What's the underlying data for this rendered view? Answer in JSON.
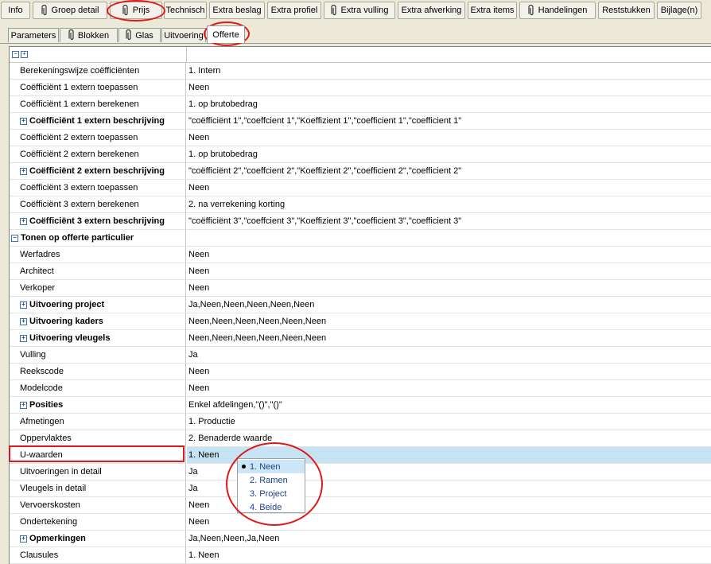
{
  "toolbar": {
    "buttons": [
      {
        "label": "Info",
        "icon": ""
      },
      {
        "label": "Groep detail",
        "icon": "paperclip-icon"
      },
      {
        "label": "Prijs",
        "icon": "paperclip-icon"
      },
      {
        "label": "Technisch",
        "icon": ""
      },
      {
        "label": "Extra beslag",
        "icon": ""
      },
      {
        "label": "Extra profiel",
        "icon": ""
      },
      {
        "label": "Extra vulling",
        "icon": "paperclip-icon"
      },
      {
        "label": "Extra afwerking",
        "icon": ""
      },
      {
        "label": "Extra items",
        "icon": ""
      },
      {
        "label": "Handelingen",
        "icon": "paperclip-icon"
      },
      {
        "label": "Reststukken",
        "icon": ""
      },
      {
        "label": "Bijlage(n)",
        "icon": ""
      }
    ]
  },
  "tabs": [
    {
      "label": "Parameters"
    },
    {
      "label": "Blokken",
      "icon": "paperclip-icon"
    },
    {
      "label": "Glas",
      "icon": "paperclip-icon"
    },
    {
      "label": "Uitvoering"
    },
    {
      "label": "Offerte",
      "active": true
    }
  ],
  "grid": {
    "header_toggle": [
      "−",
      "+"
    ],
    "rows": [
      {
        "label": "Berekeningswijze coëfficiënten",
        "value": "1. Intern"
      },
      {
        "label": "Coëfficiënt 1 extern toepassen",
        "value": "Neen"
      },
      {
        "label": "Coëfficiënt 1 extern berekenen",
        "value": "1. op brutobedrag"
      },
      {
        "label": "Coëfficiënt 1  extern beschrijving",
        "value": "\"coëfficiënt 1\",\"coeffcient 1\",\"Koeffizient 1\",\"coefficient 1\",\"coefficient 1\"",
        "expand": "+",
        "bold": true
      },
      {
        "label": "Coëfficiënt 2 extern toepassen",
        "value": "Neen"
      },
      {
        "label": "Coëfficiënt 2 extern berekenen",
        "value": "1. op brutobedrag"
      },
      {
        "label": "Coëfficiënt 2  extern beschrijving",
        "value": "\"coëfficiënt 2\",\"coeffcient 2\",\"Koeffizient 2\",\"coefficient 2\",\"coefficient 2\"",
        "expand": "+",
        "bold": true
      },
      {
        "label": "Coëfficiënt 3 extern toepassen",
        "value": "Neen"
      },
      {
        "label": "Coëfficiënt 3  extern berekenen",
        "value": "2. na verrekening korting"
      },
      {
        "label": "Coëfficiënt 3  extern beschrijving",
        "value": "\"coëfficiënt 3\",\"coeffcient 3\",\"Koeffizient 3\",\"coefficient 3\",\"coefficient 3\"",
        "expand": "+",
        "bold": true
      },
      {
        "label": "Tonen op offerte particulier",
        "value": "",
        "expand": "−",
        "group": true
      },
      {
        "label": "Werfadres",
        "value": "Neen"
      },
      {
        "label": "Architect",
        "value": "Neen"
      },
      {
        "label": "Verkoper",
        "value": "Neen"
      },
      {
        "label": "Uitvoering project",
        "value": "Ja,Neen,Neen,Neen,Neen,Neen",
        "expand": "+",
        "bold": true
      },
      {
        "label": "Uitvoering kaders",
        "value": "Neen,Neen,Neen,Neen,Neen,Neen",
        "expand": "+",
        "bold": true
      },
      {
        "label": "Uitvoering vleugels",
        "value": "Neen,Neen,Neen,Neen,Neen,Neen",
        "expand": "+",
        "bold": true
      },
      {
        "label": "Vulling",
        "value": "Ja"
      },
      {
        "label": "Reekscode",
        "value": "Neen"
      },
      {
        "label": "Modelcode",
        "value": "Neen"
      },
      {
        "label": "Posities",
        "value": "Enkel afdelingen,\"()\",\"()\"",
        "expand": "+",
        "bold": true
      },
      {
        "label": "Afmetingen",
        "value": "1. Productie"
      },
      {
        "label": "Oppervlaktes",
        "value": "2. Benaderde waarde"
      },
      {
        "label": "U-waarden",
        "value": "1. Neen",
        "selected": true
      },
      {
        "label": "Uitvoeringen in detail",
        "value": "Ja"
      },
      {
        "label": "Vleugels in detail",
        "value": "Ja"
      },
      {
        "label": "Vervoerskosten",
        "value": "Neen"
      },
      {
        "label": "Ondertekening",
        "value": "Neen"
      },
      {
        "label": "Opmerkingen",
        "value": "Ja,Neen,Neen,Ja,Neen",
        "expand": "+",
        "bold": true
      },
      {
        "label": "Clausules",
        "value": "1. Neen"
      }
    ]
  },
  "dropdown": {
    "options": [
      "1. Neen",
      "2. Ramen",
      "3. Project",
      "4. Beide"
    ],
    "selected_index": 0
  },
  "colors": {
    "annotation": "#e01818",
    "selection": "#c5e3f3"
  }
}
